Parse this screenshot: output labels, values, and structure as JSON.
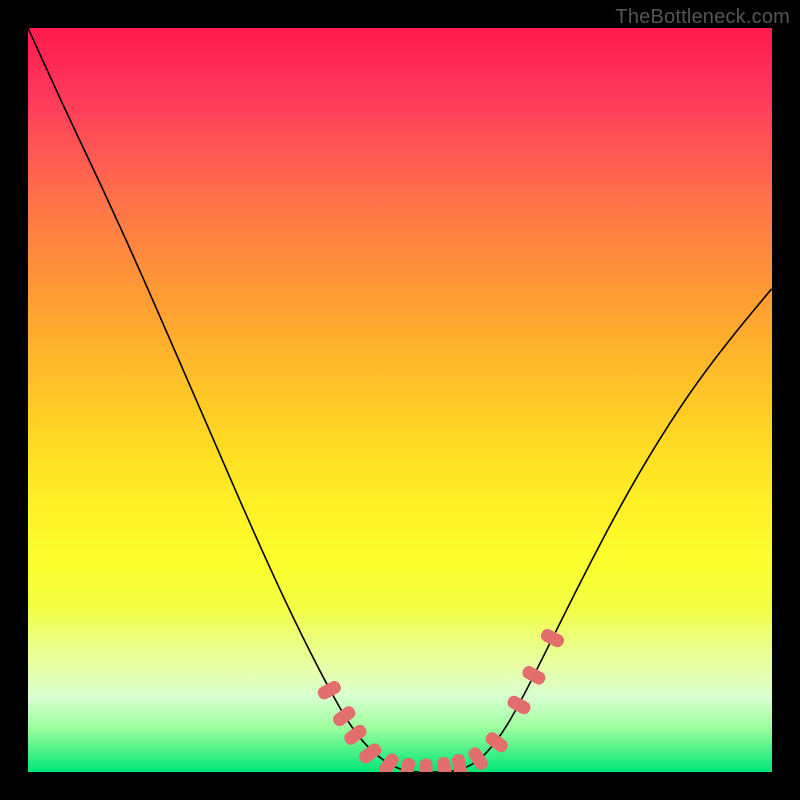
{
  "attribution": "TheBottleneck.com",
  "colors": {
    "bead": "#e26e6e",
    "curve": "#000000",
    "frame": "#000000",
    "gradient_top": "#ff1a4d",
    "gradient_bottom": "#00e676"
  },
  "chart_data": {
    "type": "line",
    "title": "",
    "xlabel": "",
    "ylabel": "",
    "xlim": [
      0,
      100
    ],
    "ylim": [
      0,
      100
    ],
    "grid": false,
    "legend": false,
    "series": [
      {
        "name": "bottleneck-curve",
        "x": [
          0,
          5,
          10,
          15,
          20,
          25,
          30,
          35,
          40,
          44,
          48,
          51,
          54,
          57,
          60,
          63,
          66,
          70,
          75,
          80,
          85,
          90,
          95,
          100
        ],
        "y": [
          100,
          89,
          78.5,
          67.5,
          56,
          44.5,
          33,
          22,
          12,
          5,
          1.2,
          0,
          0,
          0,
          1,
          4,
          9,
          17,
          27,
          36.5,
          45,
          52.5,
          59,
          65
        ],
        "note": "y is read as percentage height from the bottom of the colored plot area; values estimated from gridless gradient."
      }
    ],
    "markers": {
      "name": "highlight-beads",
      "color": "#e26e6e",
      "shape": "rounded-rect",
      "points": [
        {
          "x": 40.5,
          "y": 11
        },
        {
          "x": 42.5,
          "y": 7.5
        },
        {
          "x": 44,
          "y": 5
        },
        {
          "x": 46,
          "y": 2.5
        },
        {
          "x": 48.5,
          "y": 1
        },
        {
          "x": 51,
          "y": 0.3
        },
        {
          "x": 53.5,
          "y": 0.2
        },
        {
          "x": 56,
          "y": 0.4
        },
        {
          "x": 58,
          "y": 0.8
        },
        {
          "x": 60.5,
          "y": 1.8
        },
        {
          "x": 63,
          "y": 4
        },
        {
          "x": 66,
          "y": 9
        },
        {
          "x": 68,
          "y": 13
        },
        {
          "x": 70.5,
          "y": 18
        }
      ]
    }
  }
}
